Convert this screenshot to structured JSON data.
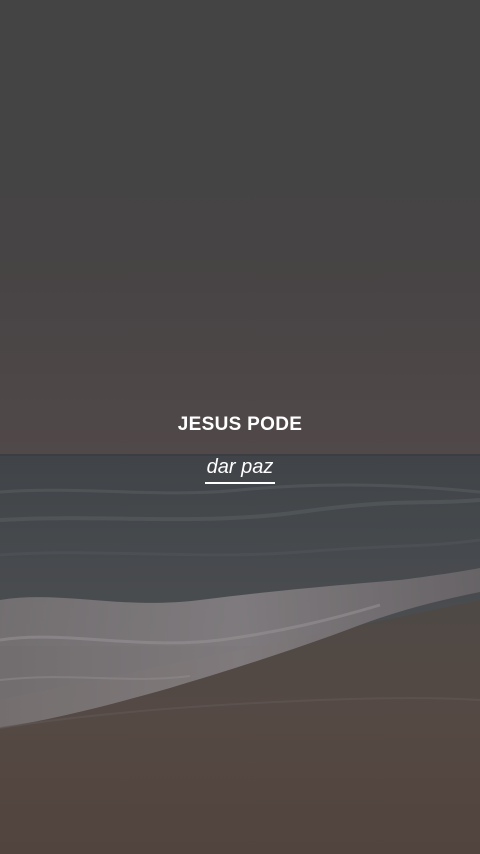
{
  "overlay": {
    "headline": "JESUS PODE",
    "subline": "dar paz"
  },
  "background": {
    "scene": "beach-at-dusk",
    "colors": {
      "sky_top": "#4a4a4b",
      "sky_horizon": "#5a5050",
      "sea": "#4b4f52",
      "foam": "#8f8a8c",
      "sand": "#5e4e46"
    }
  }
}
